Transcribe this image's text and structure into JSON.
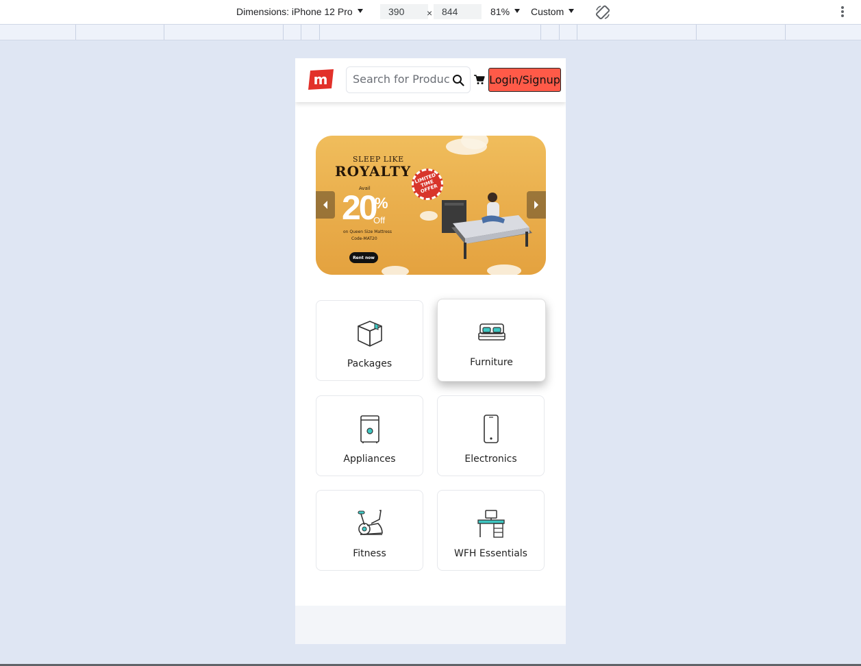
{
  "devtools": {
    "dimensions_label": "Dimensions: iPhone 12 Pro",
    "width": "390",
    "height": "844",
    "times": "×",
    "zoom": "81%",
    "throttle": "Custom"
  },
  "navbar": {
    "logo_letter": "m",
    "search_placeholder": "Search for Products",
    "login_label": "Login/Signup",
    "icons": [
      "search-icon",
      "cart-icon"
    ]
  },
  "banner": {
    "title_line1": "SLEEP LIKE",
    "title_line2": "ROYALTY",
    "avail": "Avail",
    "discount": "20",
    "percent_sign": "%",
    "off": "Off",
    "sub_line1": "on Queen Size Mattress",
    "sub_line2": "Code-MAT20",
    "stamp": "LIMITED TIME OFFER",
    "cta": "Rent now"
  },
  "categories": [
    {
      "label": "Packages",
      "icon": "box-icon",
      "active": false
    },
    {
      "label": "Furniture",
      "icon": "bed-icon",
      "active": true
    },
    {
      "label": "Appliances",
      "icon": "washer-icon",
      "active": false
    },
    {
      "label": "Electronics",
      "icon": "phone-icon",
      "active": false
    },
    {
      "label": "Fitness",
      "icon": "exercise-bike-icon",
      "active": false
    },
    {
      "label": "WFH Essentials",
      "icon": "desk-icon",
      "active": false
    }
  ],
  "colors": {
    "accent": "#ff5a48",
    "logo_red": "#e2312a",
    "icon_teal": "#3ec7c2",
    "page_bg": "#dfe6f3"
  }
}
